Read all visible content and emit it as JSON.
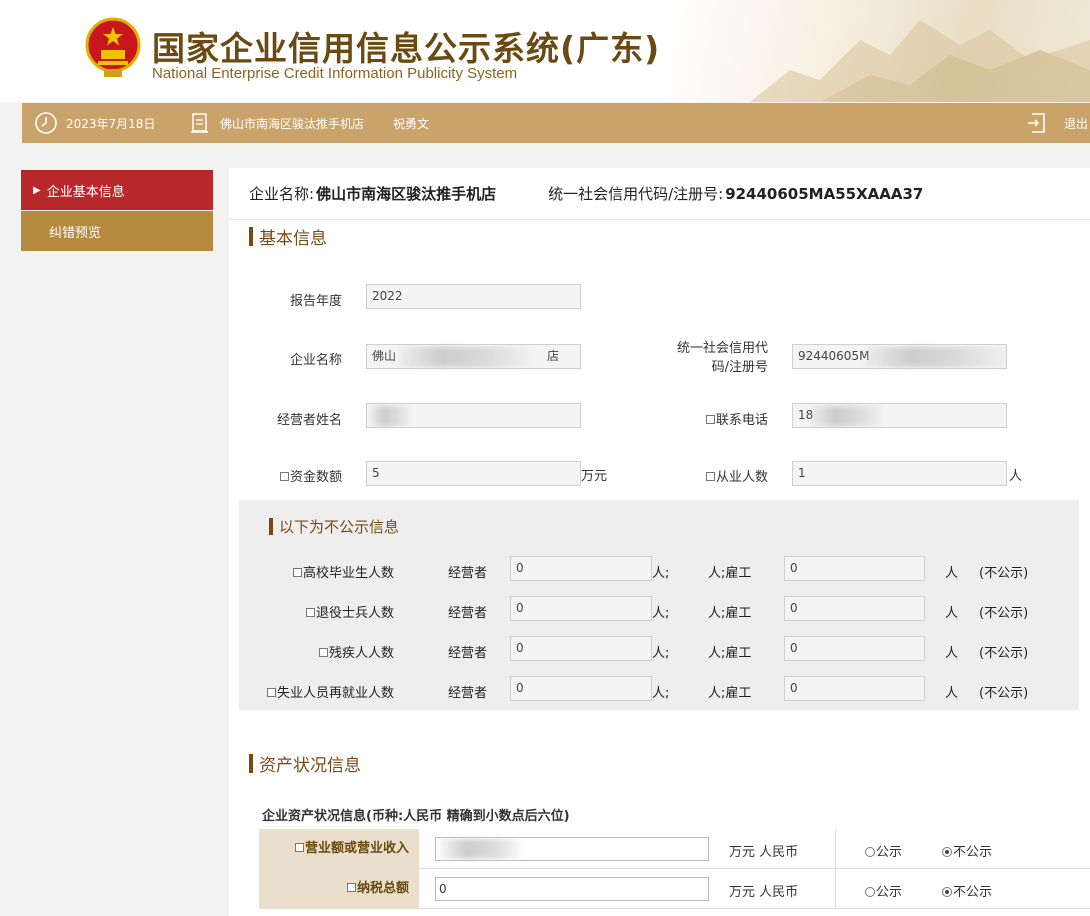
{
  "header": {
    "title_cn": "国家企业信用信息公示系统(广东)",
    "title_en": "National Enterprise Credit Information Publicity System"
  },
  "topbar": {
    "date": "2023年7月18日",
    "enterprise": "佛山市南海区骏汰推手机店",
    "user": "祝勇文",
    "logout": "退出"
  },
  "sidebar": {
    "items": [
      {
        "label": "企业基本信息",
        "active": true
      },
      {
        "label": "纠错预览",
        "active": false
      }
    ]
  },
  "enterprise_header": {
    "name_label": "企业名称:",
    "name": "佛山市南海区骏汰推手机店",
    "code_label": "统一社会信用代码/注册号:",
    "code": "92440605MA55XAAA37"
  },
  "basic": {
    "section_title": "基本信息",
    "report_year_label": "报告年度",
    "report_year": "2022",
    "name_label": "企业名称",
    "name_visible_start": "佛山",
    "name_visible_end": "店",
    "credit_code_label_1": "统一社会信用代",
    "credit_code_label_2": "码/注册号",
    "credit_code_visible": "92440605M",
    "operator_label": "经营者姓名",
    "operator_visible": "",
    "phone_label": "联系电话",
    "phone_visible": "18",
    "capital_label": "资金数额",
    "capital": "5",
    "capital_unit": "万元",
    "employees_label": "从业人数",
    "employees": "1",
    "employees_unit": "人"
  },
  "nonpublic": {
    "section_title": "以下为不公示信息",
    "operator_text": "经营者",
    "unit_semicolon": "人;",
    "employed_text": "人;雇工",
    "unit": "人",
    "hidden_text": "(不公示)",
    "rows": [
      {
        "label": "高校毕业生人数",
        "operator_value": "0",
        "employee_value": "0"
      },
      {
        "label": "退役士兵人数",
        "operator_value": "0",
        "employee_value": "0"
      },
      {
        "label": "残疾人人数",
        "operator_value": "0",
        "employee_value": "0"
      },
      {
        "label": "失业人员再就业人数",
        "operator_value": "0",
        "employee_value": "0"
      }
    ]
  },
  "assets": {
    "section_title": "资产状况信息",
    "subtitle": "企业资产状况信息(币种:人民币 精确到小数点后六位)",
    "unit": "万元 人民币",
    "public_label": "公示",
    "nonpublic_label": "不公示",
    "rows": [
      {
        "label": "营业额或营业收入",
        "value": "",
        "selected": "不公示"
      },
      {
        "label": "纳税总额",
        "value": "0",
        "selected": "不公示"
      }
    ]
  },
  "colors": {
    "brand_gold": "#c9a36a",
    "active_red": "#b8282a",
    "section_brown": "#7a4a14"
  }
}
